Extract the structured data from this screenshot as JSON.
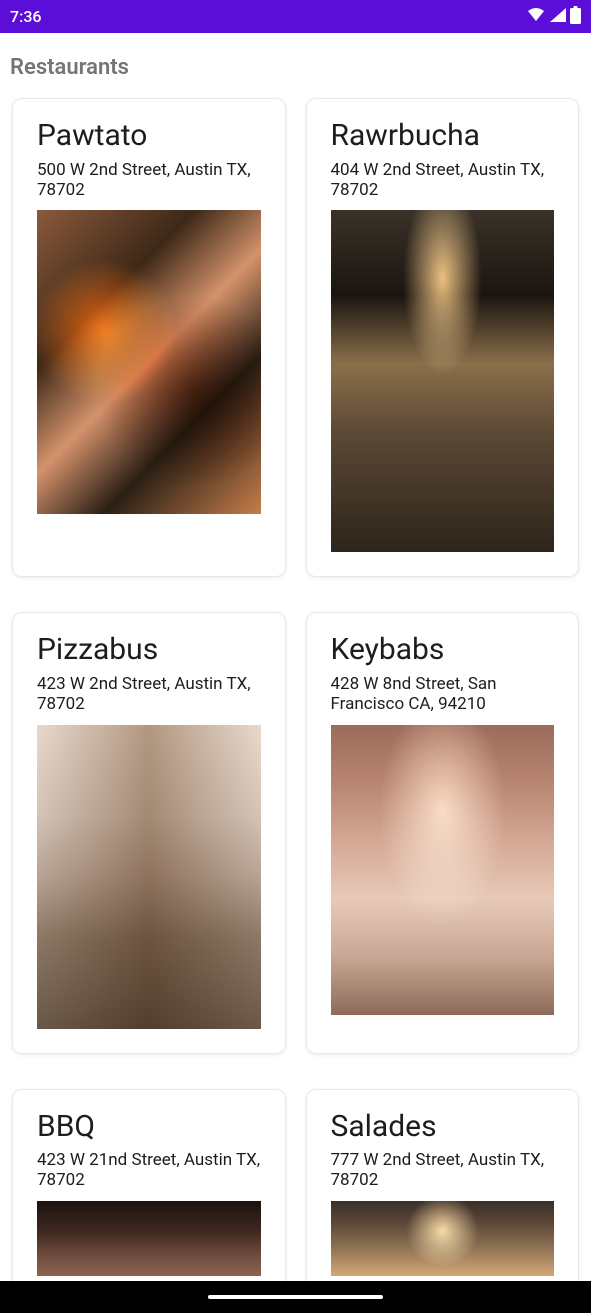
{
  "statusBar": {
    "time": "7:36"
  },
  "pageTitle": "Restaurants",
  "restaurants": [
    {
      "name": "Pawtato",
      "address": "500 W 2nd Street, Austin TX, 78702"
    },
    {
      "name": "Rawrbucha",
      "address": "404 W 2nd Street, Austin TX, 78702"
    },
    {
      "name": "Pizzabus",
      "address": "423 W 2nd Street, Austin TX, 78702"
    },
    {
      "name": "Keybabs",
      "address": "428 W 8nd Street, San Francisco CA, 94210"
    },
    {
      "name": "BBQ",
      "address": "423 W 21nd Street, Austin TX, 78702"
    },
    {
      "name": "Salades",
      "address": "777 W 2nd Street, Austin TX, 78702"
    }
  ]
}
